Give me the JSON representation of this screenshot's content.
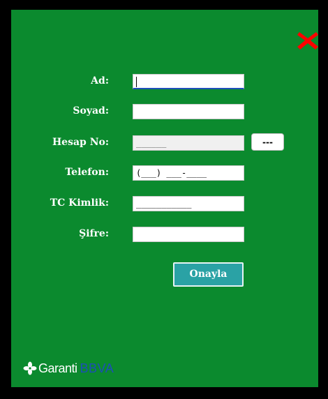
{
  "form": {
    "fields": [
      {
        "label": "Ad:",
        "value": ""
      },
      {
        "label": "Soyad:",
        "value": ""
      },
      {
        "label": "Hesap No:",
        "value": "______"
      },
      {
        "label": "Telefon:",
        "value": "(___) ___-____"
      },
      {
        "label": "TC Kimlik:",
        "value": "___________"
      },
      {
        "label": "Şifre:",
        "value": ""
      }
    ],
    "browse_label": "---",
    "submit_label": "Onayla"
  },
  "brand": {
    "name": "Garanti",
    "suffix": "BBVA"
  },
  "colors": {
    "background": "#0b8a2e",
    "close_icon": "#ff0000",
    "button": "#2aa2a5",
    "brand_blue": "#1d4fb8"
  },
  "icons": {
    "close": "close-icon",
    "logo": "garanti-clover-icon"
  }
}
